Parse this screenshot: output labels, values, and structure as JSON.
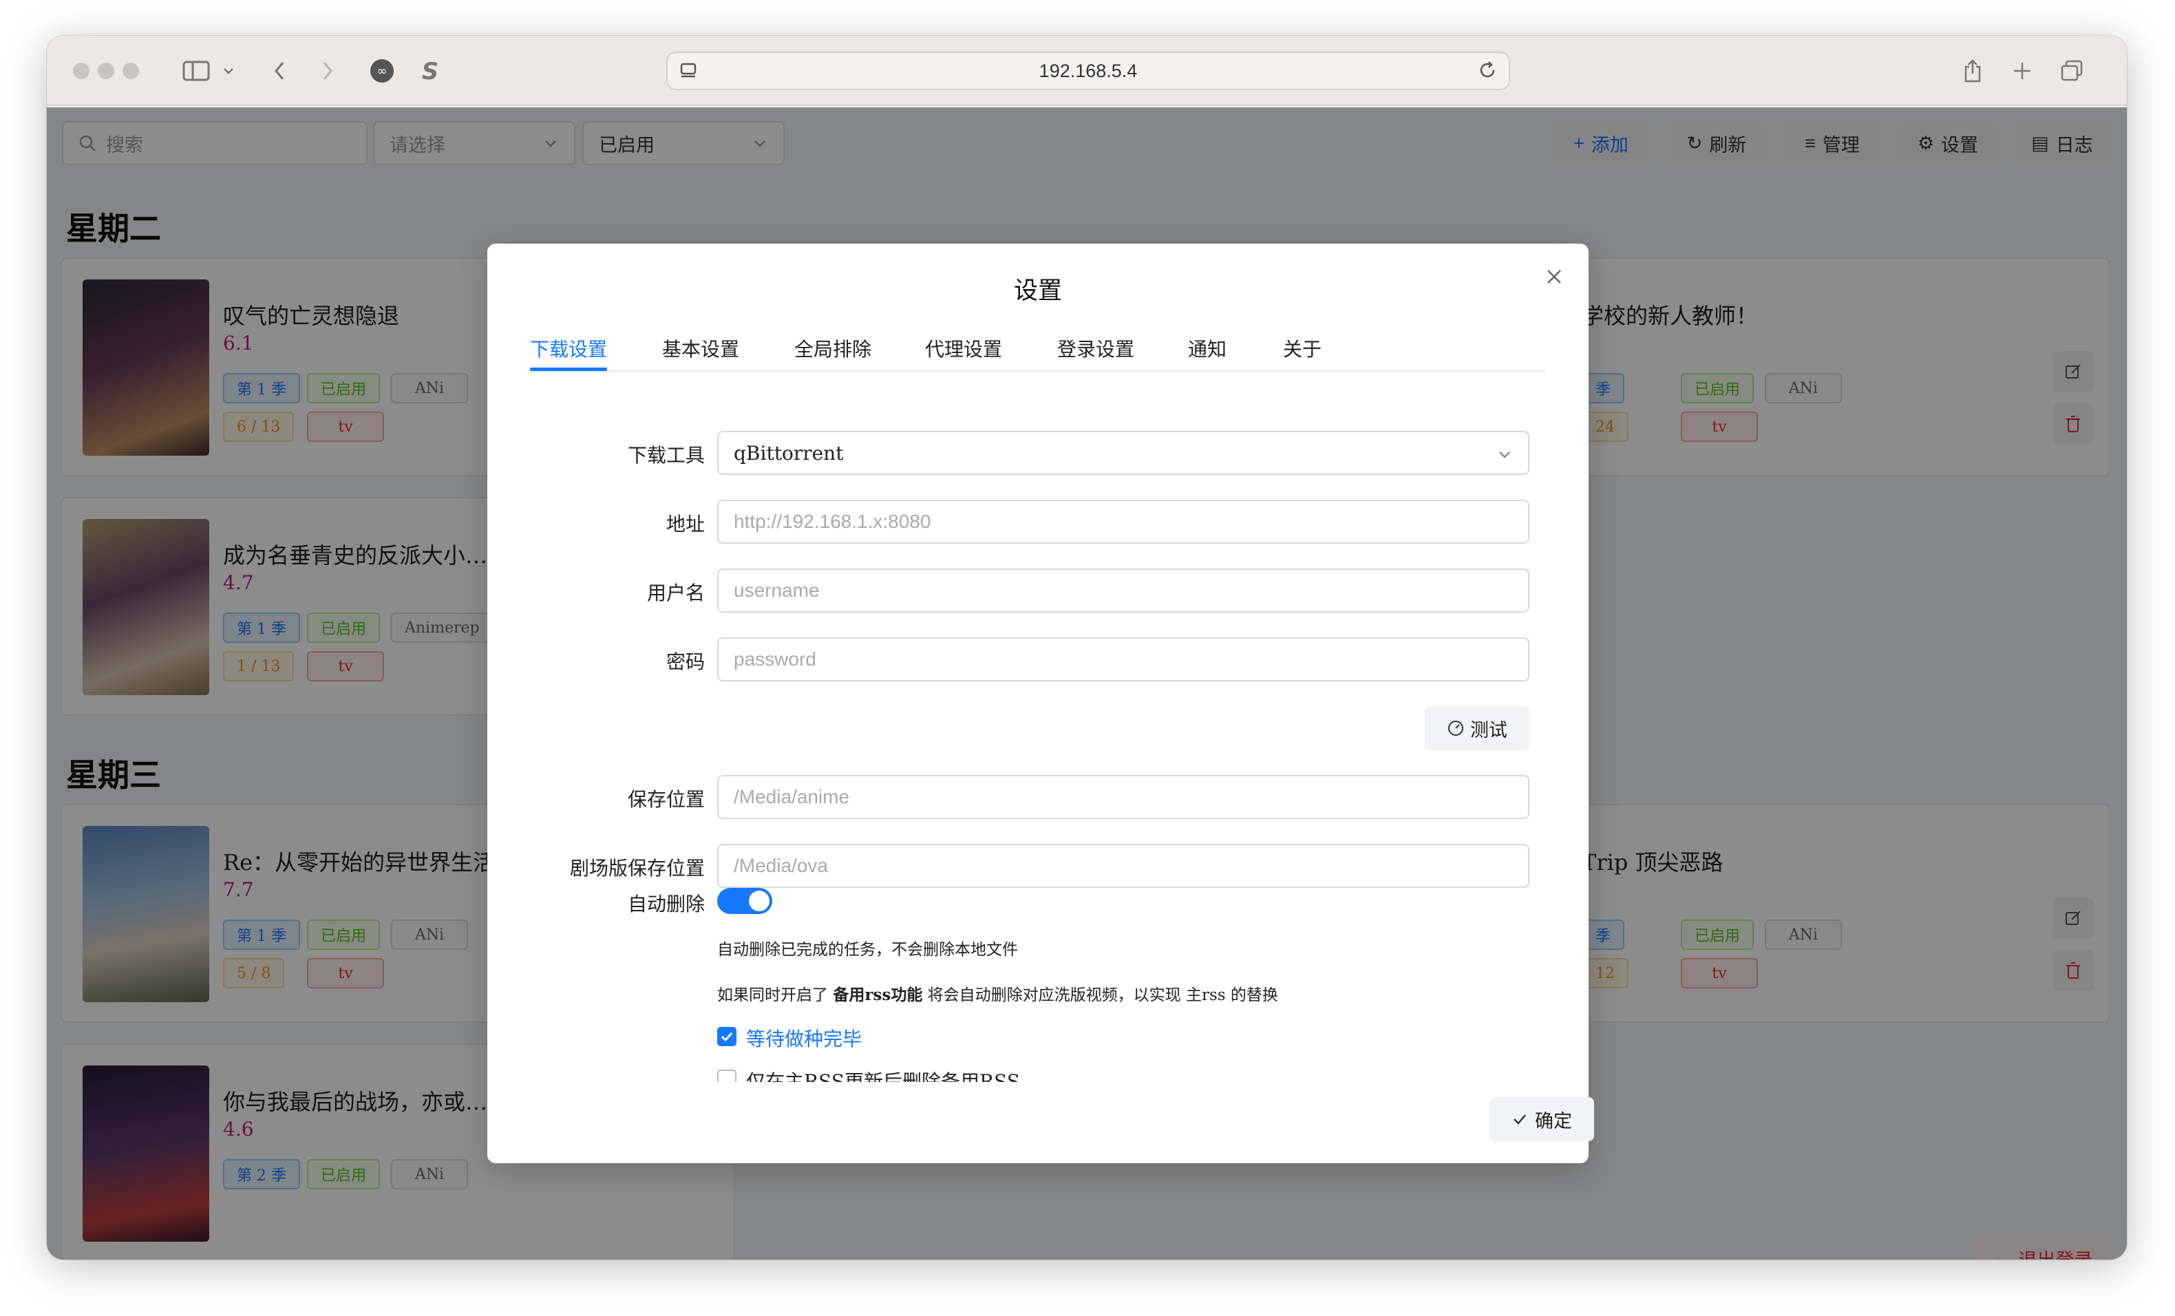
{
  "browser": {
    "url": "192.168.5.4"
  },
  "toolbar": {
    "search_placeholder": "搜索",
    "select_placeholder": "请选择",
    "status_value": "已启用",
    "add_label": "添加",
    "refresh_label": "刷新",
    "manage_label": "管理",
    "settings_label": "设置",
    "log_label": "日志",
    "logout_label": "退出登录"
  },
  "days": [
    {
      "label": "星期二"
    },
    {
      "label": "星期三"
    }
  ],
  "cards": [
    {
      "title": "叹气的亡灵想隐退",
      "score": "6.1",
      "season": "第 1 季",
      "status": "已启用",
      "group": "ANi",
      "progress": "6 / 13",
      "type": "tv"
    },
    {
      "title": "学校的新人教师！",
      "season": "季",
      "status": "已启用",
      "group": "ANi",
      "progress": "24",
      "type": "tv"
    },
    {
      "title": "成为名垂青史的反派大小…",
      "score": "4.7",
      "season": "第 1 季",
      "status": "已启用",
      "group": "Animerep",
      "progress": "1 / 13",
      "type": "tv"
    },
    {
      "title": "Re：从零开始的异世界生活",
      "score": "7.7",
      "season": "第 1 季",
      "status": "已启用",
      "group": "ANi",
      "progress": "5 / 8",
      "type": "tv"
    },
    {
      "title": "Trip 顶尖恶路",
      "season": "季",
      "status": "已启用",
      "group": "ANi",
      "progress": "12",
      "type": "tv"
    },
    {
      "title": "你与我最后的战场，亦或…",
      "score": "4.6",
      "season": "第 2 季",
      "status": "已启用",
      "group": "ANi"
    }
  ],
  "modal": {
    "title": "设置",
    "tabs": [
      "下载设置",
      "基本设置",
      "全局排除",
      "代理设置",
      "登录设置",
      "通知",
      "关于"
    ],
    "active_tab": "下载设置",
    "fields": {
      "download_tool_label": "下载工具",
      "download_tool_value": "qBittorrent",
      "address_label": "地址",
      "address_placeholder": "http://192.168.1.x:8080",
      "username_label": "用户名",
      "username_placeholder": "username",
      "password_label": "密码",
      "password_placeholder": "password",
      "test_label": "测试",
      "save_path_label": "保存位置",
      "save_path_placeholder": "/Media/anime",
      "movie_path_label": "剧场版保存位置",
      "movie_path_placeholder": "/Media/ova",
      "auto_delete_label": "自动删除",
      "auto_delete_on": true,
      "hint1": "自动删除已完成的任务，不会删除本地文件",
      "hint2_prefix": "如果同时开启了 ",
      "hint2_bold": "备用rss功能",
      "hint2_suffix": " 将会自动删除对应洗版视频，以实现 主rss 的替换",
      "wait_seed_label": "等待做种完毕",
      "wait_seed_checked": true,
      "delete_after_label": "仅在主RSS更新后删除备用RSS",
      "delete_after_checked": false
    },
    "ok_label": "确定"
  },
  "colors": {
    "accent": "#1677ff",
    "score": "#c41d7f",
    "danger": "#f5222d"
  }
}
